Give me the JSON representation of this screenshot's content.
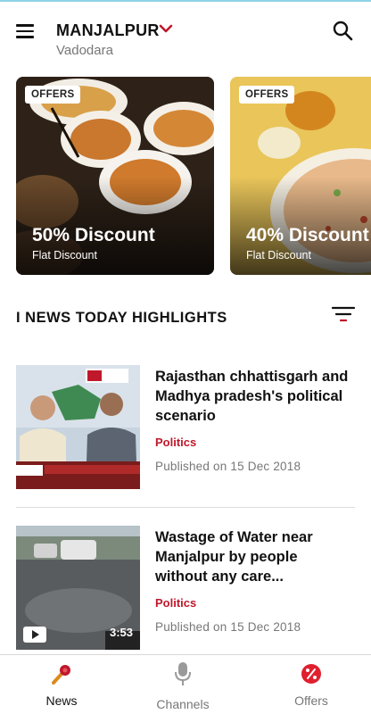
{
  "header": {
    "location": "MANJALPUR",
    "city": "Vadodara",
    "menu_icon": "hamburger-menu-icon",
    "search_icon": "search-icon"
  },
  "offers": [
    {
      "badge": "OFFERS",
      "title": "50% Discount",
      "subtitle": "Flat Discount"
    },
    {
      "badge": "OFFERS",
      "title": "40% Discount",
      "subtitle": "Flat Discount"
    }
  ],
  "highlights": {
    "title": "I NEWS TODAY HIGHLIGHTS",
    "filter_icon": "filter-icon"
  },
  "news": [
    {
      "headline": "Rajasthan chhattisgarh and Madhya pradesh's political scenario",
      "category": "Politics",
      "date": "Published on 15 Dec 2018"
    },
    {
      "headline": "Wastage of Water near Manjalpur by people without any care...",
      "category": "Politics",
      "date": "Published on 15 Dec 2018",
      "duration": "3:53"
    }
  ],
  "bottom_nav": [
    {
      "label": "News",
      "icon": "microphone-news-icon",
      "active": true
    },
    {
      "label": "Channels",
      "icon": "studio-microphone-icon",
      "active": false
    },
    {
      "label": "Offers",
      "icon": "percent-offer-icon",
      "active": false
    }
  ],
  "colors": {
    "accent": "#c0182b",
    "text": "#111111",
    "muted": "#777777"
  }
}
